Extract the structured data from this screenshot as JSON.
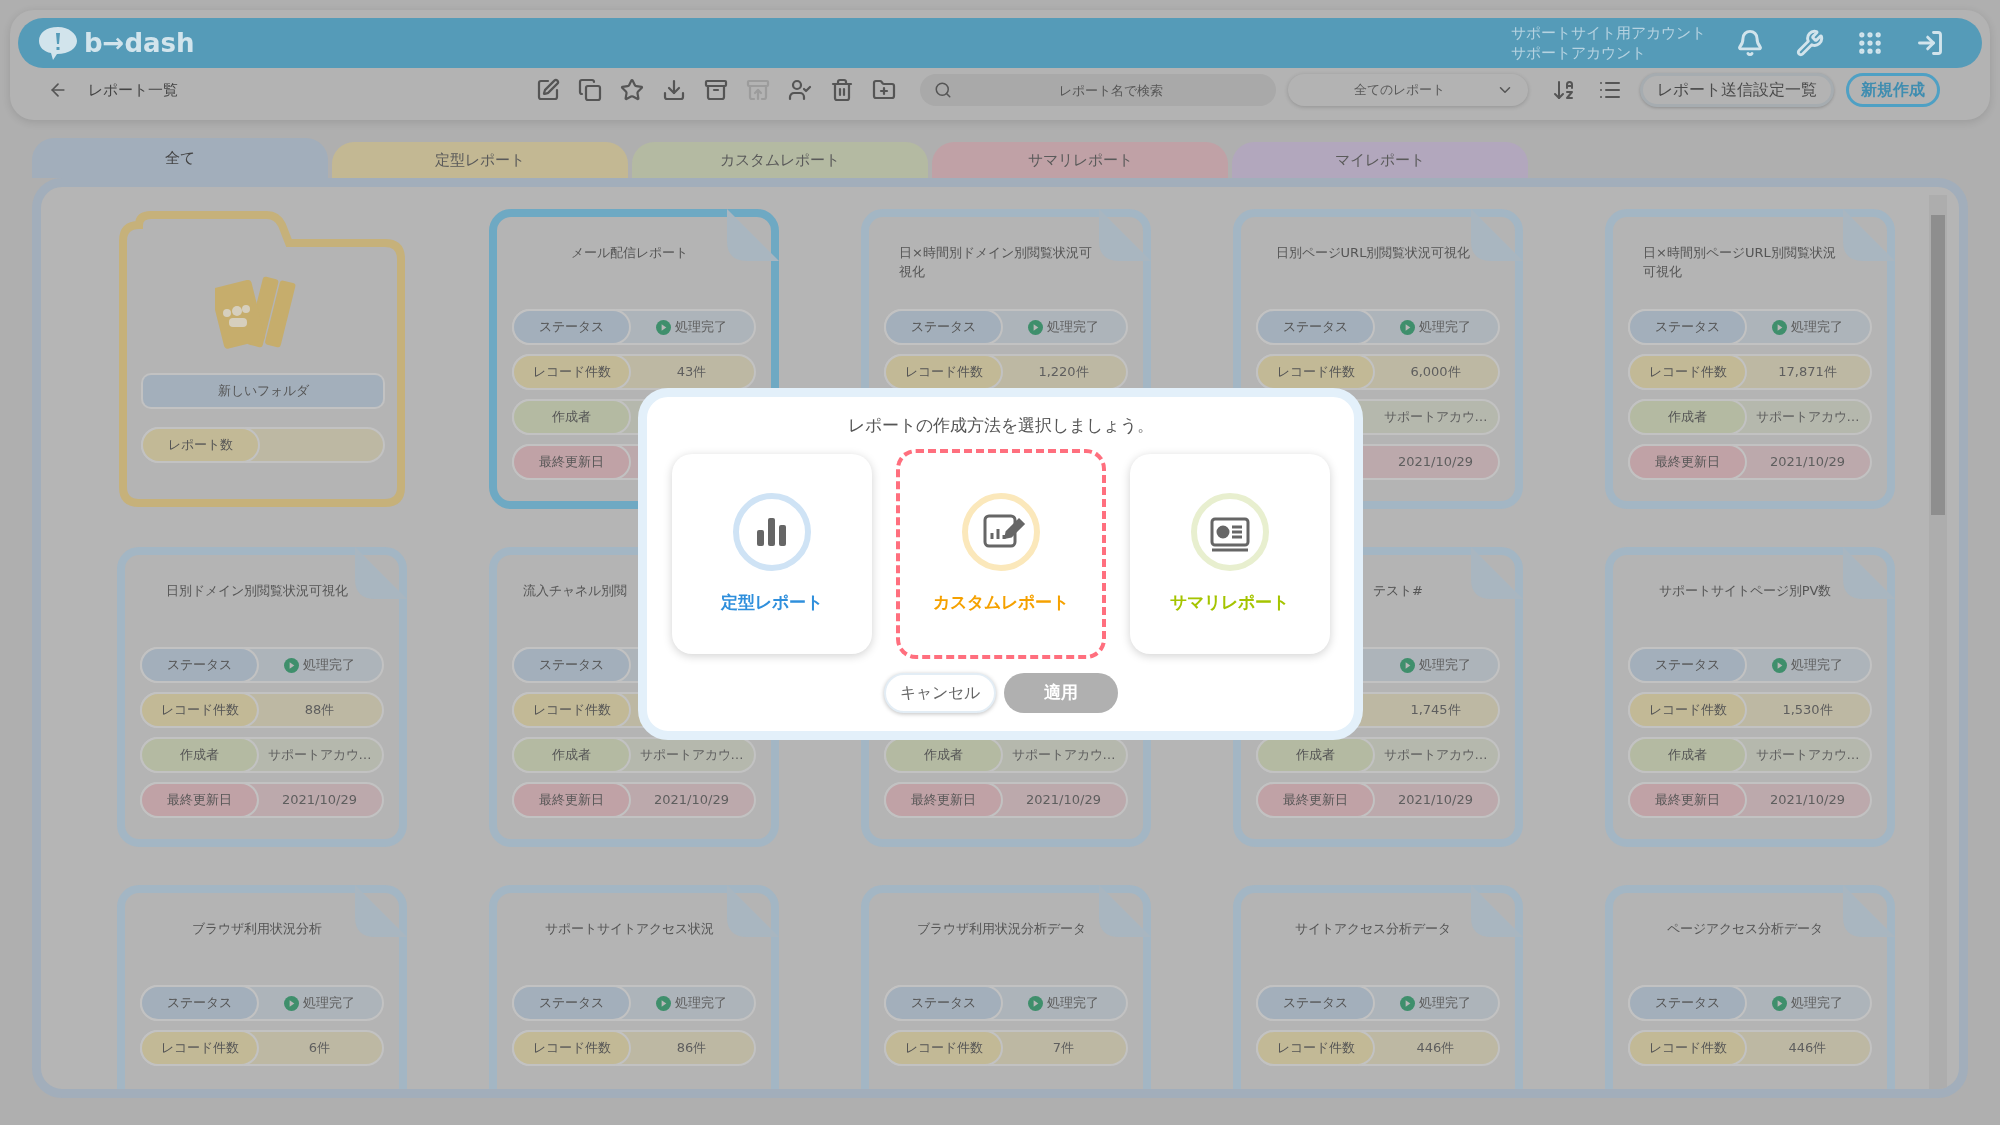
{
  "header": {
    "logo": "b→dash",
    "account_lines": [
      "サポートサイト用アカウント",
      "サポートアカウント"
    ],
    "icons": [
      {
        "kind": "bell"
      },
      {
        "kind": "wrench"
      },
      {
        "kind": "grid"
      },
      {
        "kind": "logout"
      }
    ]
  },
  "toolbar": {
    "page_title": "レポート一覧",
    "icons": [
      {
        "kind": "edit",
        "disabled": false
      },
      {
        "kind": "copy",
        "disabled": false
      },
      {
        "kind": "star",
        "disabled": false
      },
      {
        "kind": "download",
        "disabled": false
      },
      {
        "kind": "archive-down",
        "disabled": false
      },
      {
        "kind": "archive-up",
        "disabled": true
      },
      {
        "kind": "user-check",
        "disabled": false
      },
      {
        "kind": "trash",
        "disabled": false
      },
      {
        "kind": "folder-plus",
        "disabled": false
      }
    ],
    "search": {
      "placeholder": "レポート名で検索"
    },
    "filter": {
      "value": "全てのレポート"
    },
    "view_icons": [
      {
        "kind": "sort-az"
      },
      {
        "kind": "list"
      }
    ],
    "buttons": [
      {
        "label": "レポート送信設定一覧",
        "kind": "secondary"
      },
      {
        "label": "新規作成",
        "kind": "primary"
      }
    ]
  },
  "tabs": [
    {
      "label": "全て",
      "selected": true,
      "color": "#a2aebb"
    },
    {
      "label": "定型レポート",
      "selected": false,
      "color": "#c3b893"
    },
    {
      "label": "カスタムレポート",
      "selected": false,
      "color": "#b4baa2"
    },
    {
      "label": "サマリレポート",
      "selected": false,
      "color": "#c0a1a6"
    },
    {
      "label": "マイレポート",
      "selected": false,
      "color": "#b2a7bd"
    }
  ],
  "folder": {
    "name": "新しいフォルダ",
    "count_label": "レポート数"
  },
  "cards": [
    {
      "title": "メール配信レポート",
      "selected": true,
      "fields": [
        {
          "kind": "status",
          "label": "ステータス",
          "value": "処理完了"
        },
        {
          "kind": "count",
          "label": "レコード件数",
          "value": "43件"
        },
        {
          "kind": "author",
          "label": "作成者"
        },
        {
          "kind": "updated",
          "label": "最終更新日"
        }
      ]
    },
    {
      "title": "日×時間別ドメイン別閲覧状況可視化",
      "selected": false,
      "fields": [
        {
          "kind": "status",
          "label": "ステータス",
          "value": "処理完了"
        },
        {
          "kind": "count",
          "label": "レコード件数",
          "value": "1,220件"
        }
      ]
    },
    {
      "title": "日別ページURL別閲覧状況可視化",
      "selected": false,
      "fields": [
        {
          "kind": "status",
          "label": "ステータス",
          "value": "処理完了"
        },
        {
          "kind": "count",
          "label": "レコード件数",
          "value": "6,000件"
        },
        {
          "kind": "author",
          "value": "サポートアカウ…"
        },
        {
          "kind": "updated",
          "value": "2021/10/29"
        }
      ]
    },
    {
      "title": "日×時間別ページURL別閲覧状況可視化",
      "selected": false,
      "fields": [
        {
          "kind": "status",
          "label": "ステータス",
          "value": "処理完了"
        },
        {
          "kind": "count",
          "label": "レコード件数",
          "value": "17,871件"
        },
        {
          "kind": "author",
          "label": "作成者",
          "value": "サポートアカウ…"
        },
        {
          "kind": "updated",
          "label": "最終更新日",
          "value": "2021/10/29"
        }
      ]
    },
    {
      "title": "日別ドメイン別閲覧状況可視化",
      "selected": false,
      "fields": [
        {
          "kind": "status",
          "label": "ステータス",
          "value": "処理完了"
        },
        {
          "kind": "count",
          "label": "レコード件数",
          "value": "88件"
        },
        {
          "kind": "author",
          "label": "作成者",
          "value": "サポートアカウ…"
        },
        {
          "kind": "updated",
          "label": "最終更新日",
          "value": "2021/10/29"
        }
      ]
    },
    {
      "title": "流入チャネル別閲",
      "covered_end": true,
      "selected": false,
      "fields": [
        {
          "kind": "status",
          "label": "ステータス"
        },
        {
          "kind": "count",
          "label": "レコード件数"
        },
        {
          "kind": "author",
          "label": "作成者",
          "value": "サポートアカウ…"
        },
        {
          "kind": "updated",
          "label": "最終更新日",
          "value": "2021/10/29"
        }
      ]
    },
    {
      "selected": false,
      "fields": [
        {
          "kind": "author",
          "label": "作成者",
          "value": "サポートアカウ…"
        },
        {
          "kind": "updated",
          "label": "最終更新日",
          "value": "2021/10/29"
        }
      ]
    },
    {
      "title": "テスト#",
      "covered_start": true,
      "selected": false,
      "fields": [
        {
          "kind": "status",
          "value": "処理完了"
        },
        {
          "kind": "count",
          "value": "1,745件"
        },
        {
          "kind": "author",
          "label": "作成者",
          "value": "サポートアカウ…"
        },
        {
          "kind": "updated",
          "label": "最終更新日",
          "value": "2021/10/29"
        }
      ]
    },
    {
      "title": "サポートサイトページ別PV数",
      "selected": false,
      "fields": [
        {
          "kind": "status",
          "label": "ステータス",
          "value": "処理完了"
        },
        {
          "kind": "count",
          "label": "レコード件数",
          "value": "1,530件"
        },
        {
          "kind": "author",
          "label": "作成者",
          "value": "サポートアカウ…"
        },
        {
          "kind": "updated",
          "label": "最終更新日",
          "value": "2021/10/29"
        }
      ]
    },
    {
      "title": "ブラウザ利用状況分析",
      "selected": false,
      "fields": [
        {
          "kind": "status",
          "label": "ステータス",
          "value": "処理完了"
        },
        {
          "kind": "count",
          "label": "レコード件数",
          "value": "6件"
        }
      ]
    },
    {
      "title": "サポートサイトアクセス状況",
      "selected": false,
      "fields": [
        {
          "kind": "status",
          "label": "ステータス",
          "value": "処理完了"
        },
        {
          "kind": "count",
          "label": "レコード件数",
          "value": "86件"
        }
      ]
    },
    {
      "title": "ブラウザ利用状況分析データ",
      "selected": false,
      "fields": [
        {
          "kind": "status",
          "label": "ステータス",
          "value": "処理完了"
        },
        {
          "kind": "count",
          "label": "レコード件数",
          "value": "7件"
        }
      ]
    },
    {
      "title": "サイトアクセス分析データ",
      "selected": false,
      "fields": [
        {
          "kind": "status",
          "label": "ステータス",
          "value": "処理完了"
        },
        {
          "kind": "count",
          "label": "レコード件数",
          "value": "446件"
        }
      ]
    },
    {
      "title": "ページアクセス分析データ",
      "selected": false,
      "fields": [
        {
          "kind": "status",
          "label": "ステータス",
          "value": "処理完了"
        },
        {
          "kind": "count",
          "label": "レコード件数",
          "value": "446件"
        }
      ]
    }
  ],
  "dialog": {
    "prompt": "レポートの作成方法を選択しましょう。",
    "options": [
      {
        "kind": "standard",
        "label": "定型レポート",
        "color": "#2f8fdc",
        "selected": false
      },
      {
        "kind": "custom",
        "label": "カスタムレポート",
        "color": "#f5a100",
        "selected": true
      },
      {
        "kind": "summary",
        "label": "サマリレポート",
        "color": "#a5c400",
        "selected": false
      }
    ],
    "buttons": [
      {
        "label": "キャンセル",
        "disabled": false
      },
      {
        "label": "適用",
        "disabled": true
      }
    ]
  }
}
